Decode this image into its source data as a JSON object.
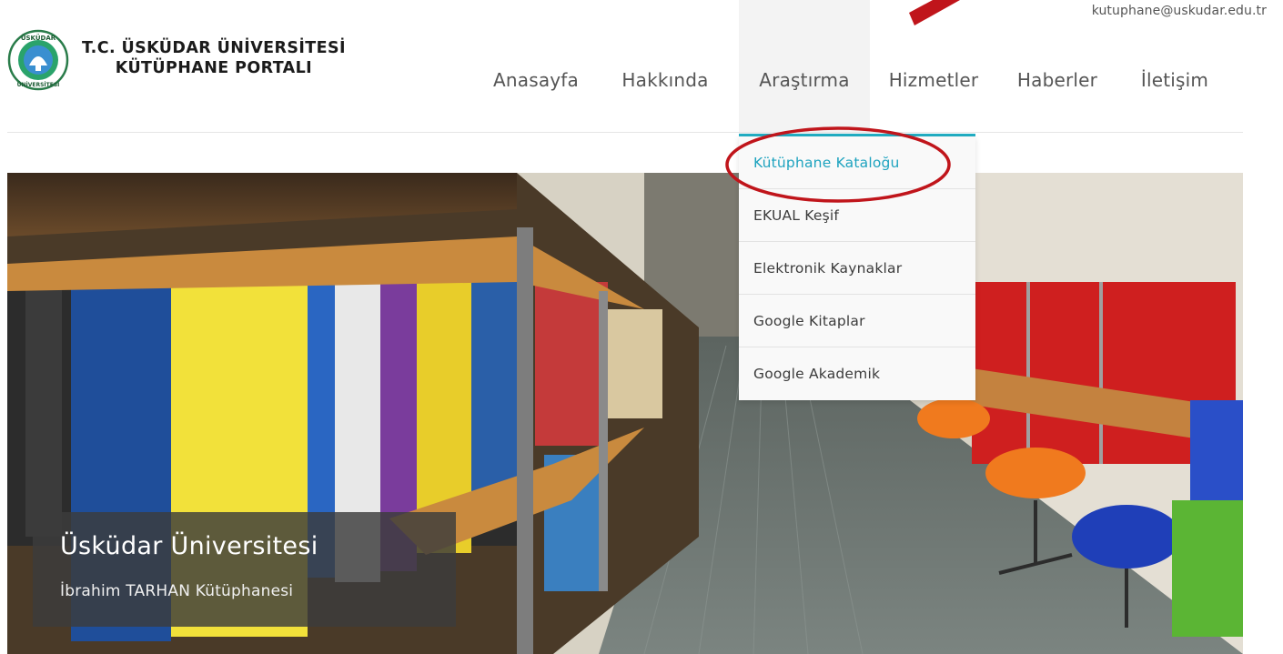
{
  "header": {
    "email": "kutuphane@uskudar.edu.tr",
    "brand_line1": "T.C. ÜSKÜDAR ÜNİVERSİTESİ",
    "brand_line2": "KÜTÜPHANE PORTALI",
    "logo_text_top": "ÜSKÜDAR",
    "logo_text_bottom": "ÜNİVERSİTESİ"
  },
  "nav": {
    "items": [
      {
        "label": "Anasayfa"
      },
      {
        "label": "Hakkında"
      },
      {
        "label": "Araştırma"
      },
      {
        "label": "Hizmetler"
      },
      {
        "label": "Haberler"
      },
      {
        "label": "İletişim"
      }
    ],
    "active_index": 2
  },
  "dropdown": {
    "items": [
      {
        "label": "Kütüphane Kataloğu"
      },
      {
        "label": "EKUAL Keşif"
      },
      {
        "label": "Elektronik Kaynaklar"
      },
      {
        "label": "Google Kitaplar"
      },
      {
        "label": "Google Akademik"
      }
    ]
  },
  "hero": {
    "caption_title": "Üsküdar Üniversitesi",
    "caption_subtitle": "İbrahim TARHAN Kütüphanesi"
  },
  "colors": {
    "accent": "#21aec4",
    "annotation": "#c0151b"
  }
}
